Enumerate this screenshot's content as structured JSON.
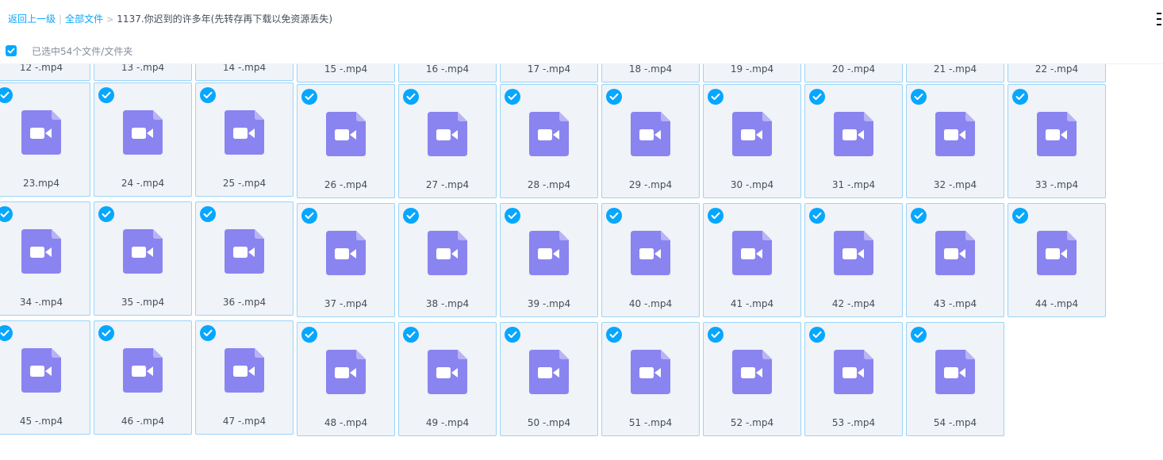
{
  "breadcrumb": {
    "back": "返回上一级",
    "separator": "|",
    "all_files": "全部文件",
    "arrow": ">",
    "current": "1137.你迟到的许多年(先转存再下载以免资源丢失)"
  },
  "selection": {
    "checked": true,
    "text": "已选中54个文件/文件夹"
  },
  "colors": {
    "accent": "#06a7ff",
    "tile_bg": "#f0f3f7",
    "tile_border": "#9ad4f8",
    "video_icon": "#8a84f0"
  },
  "files": [
    {
      "name": "12 -.mp4",
      "icon": "video-file-icon",
      "selected": true
    },
    {
      "name": "13 -.mp4",
      "icon": "video-file-icon",
      "selected": true
    },
    {
      "name": "14 -.mp4",
      "icon": "video-file-icon",
      "selected": true
    },
    {
      "name": "15 -.mp4",
      "icon": "video-file-icon",
      "selected": true
    },
    {
      "name": "16 -.mp4",
      "icon": "video-file-icon",
      "selected": true
    },
    {
      "name": "17 -.mp4",
      "icon": "video-file-icon",
      "selected": true
    },
    {
      "name": "18 -.mp4",
      "icon": "video-file-icon",
      "selected": true
    },
    {
      "name": "19 -.mp4",
      "icon": "video-file-icon",
      "selected": true
    },
    {
      "name": "20 -.mp4",
      "icon": "video-file-icon",
      "selected": true
    },
    {
      "name": "21 -.mp4",
      "icon": "video-file-icon",
      "selected": true
    },
    {
      "name": "22 -.mp4",
      "icon": "video-file-icon",
      "selected": true
    },
    {
      "name": "23.mp4",
      "icon": "video-file-icon",
      "selected": true
    },
    {
      "name": "24 -.mp4",
      "icon": "video-file-icon",
      "selected": true
    },
    {
      "name": "25 -.mp4",
      "icon": "video-file-icon",
      "selected": true
    },
    {
      "name": "26 -.mp4",
      "icon": "video-file-icon",
      "selected": true
    },
    {
      "name": "27 -.mp4",
      "icon": "video-file-icon",
      "selected": true
    },
    {
      "name": "28 -.mp4",
      "icon": "video-file-icon",
      "selected": true
    },
    {
      "name": "29 -.mp4",
      "icon": "video-file-icon",
      "selected": true
    },
    {
      "name": "30 -.mp4",
      "icon": "video-file-icon",
      "selected": true
    },
    {
      "name": "31 -.mp4",
      "icon": "video-file-icon",
      "selected": true
    },
    {
      "name": "32 -.mp4",
      "icon": "video-file-icon",
      "selected": true
    },
    {
      "name": "33 -.mp4",
      "icon": "video-file-icon",
      "selected": true
    },
    {
      "name": "34 -.mp4",
      "icon": "video-file-icon",
      "selected": true
    },
    {
      "name": "35 -.mp4",
      "icon": "video-file-icon",
      "selected": true
    },
    {
      "name": "36 -.mp4",
      "icon": "video-file-icon",
      "selected": true
    },
    {
      "name": "37 -.mp4",
      "icon": "video-file-icon",
      "selected": true
    },
    {
      "name": "38 -.mp4",
      "icon": "video-file-icon",
      "selected": true
    },
    {
      "name": "39 -.mp4",
      "icon": "video-file-icon",
      "selected": true
    },
    {
      "name": "40 -.mp4",
      "icon": "video-file-icon",
      "selected": true
    },
    {
      "name": "41 -.mp4",
      "icon": "video-file-icon",
      "selected": true
    },
    {
      "name": "42 -.mp4",
      "icon": "video-file-icon",
      "selected": true
    },
    {
      "name": "43 -.mp4",
      "icon": "video-file-icon",
      "selected": true
    },
    {
      "name": "44 -.mp4",
      "icon": "video-file-icon",
      "selected": true
    },
    {
      "name": "45 -.mp4",
      "icon": "video-file-icon",
      "selected": true
    },
    {
      "name": "46 -.mp4",
      "icon": "video-file-icon",
      "selected": true
    },
    {
      "name": "47 -.mp4",
      "icon": "video-file-icon",
      "selected": true
    },
    {
      "name": "48 -.mp4",
      "icon": "video-file-icon",
      "selected": true
    },
    {
      "name": "49 -.mp4",
      "icon": "video-file-icon",
      "selected": true
    },
    {
      "name": "50 -.mp4",
      "icon": "video-file-icon",
      "selected": true
    },
    {
      "name": "51 -.mp4",
      "icon": "video-file-icon",
      "selected": true
    },
    {
      "name": "52 -.mp4",
      "icon": "video-file-icon",
      "selected": true
    },
    {
      "name": "53 -.mp4",
      "icon": "video-file-icon",
      "selected": true
    },
    {
      "name": "54 -.mp4",
      "icon": "video-file-icon",
      "selected": true
    }
  ]
}
